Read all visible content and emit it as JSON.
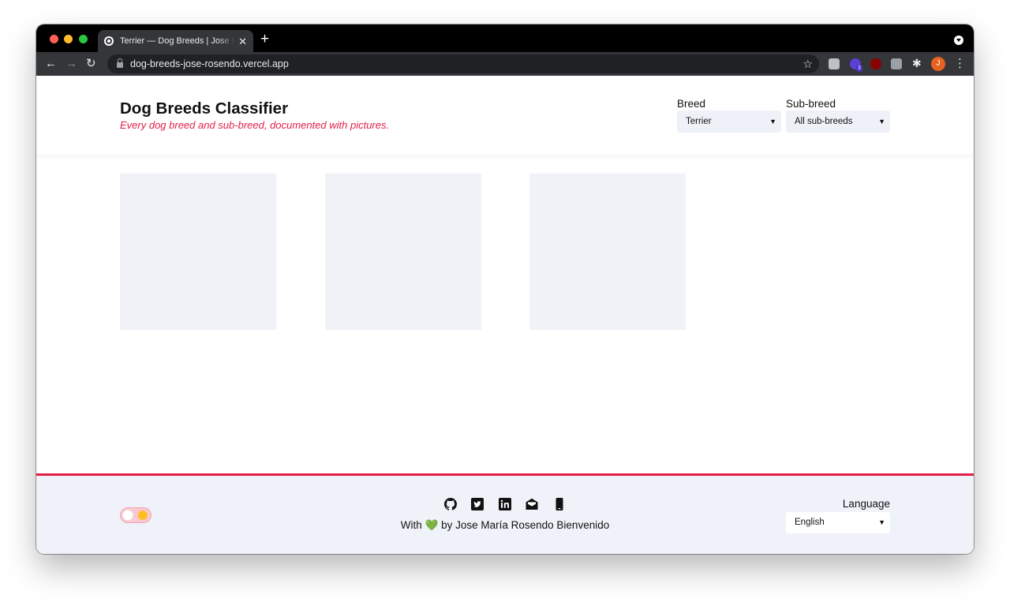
{
  "browser": {
    "tab_title": "Terrier — Dog Breeds | Jose Rosendo",
    "tab_close": "✕",
    "new_tab": "+",
    "url": "dog-breeds-jose-rosendo.vercel.app",
    "extension_badge": "3",
    "profile_initial": "J"
  },
  "header": {
    "title": "Dog Breeds Classifier",
    "subtitle": "Every dog breed and sub-breed, documented with pictures.",
    "breed_label": "Breed",
    "breed_value": "Terrier",
    "subbreed_label": "Sub-breed",
    "subbreed_value": "All sub-breeds"
  },
  "gallery": {
    "images": [
      "placeholder",
      "placeholder",
      "placeholder"
    ]
  },
  "footer": {
    "social_icons": [
      "github-icon",
      "twitter-icon",
      "linkedin-icon",
      "mail-icon",
      "phone-icon"
    ],
    "credit_prefix": "With",
    "credit_heart": "💚",
    "credit_suffix": "by Jose María Rosendo Bienvenido",
    "language_label": "Language",
    "language_value": "English"
  },
  "colors": {
    "accent": "#e11d48",
    "placeholder": "#f0f2f7",
    "footer_bg": "#f0f2fa"
  }
}
